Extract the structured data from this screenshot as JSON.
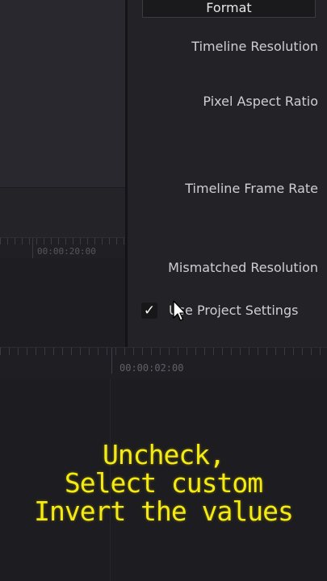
{
  "settings": {
    "tab_label": "Format",
    "labels": {
      "timeline_resolution": "Timeline Resolution",
      "pixel_aspect_ratio": "Pixel Aspect Ratio",
      "timeline_frame_rate": "Timeline Frame Rate",
      "mismatched_resolution": "Mismatched Resolution"
    },
    "use_project_settings": {
      "label": "Use Project Settings",
      "checked": true,
      "check_glyph": "✓"
    }
  },
  "timeline": {
    "upper_timecode": "00:00:20:00",
    "lower_timecode": "00:00:02:00"
  },
  "caption": {
    "lines": [
      "Uncheck,",
      "Select custom",
      "Invert the values"
    ],
    "color": "#f4ea16"
  },
  "icons": {
    "cursor": "mouse-pointer-icon",
    "check": "checkmark-icon"
  }
}
